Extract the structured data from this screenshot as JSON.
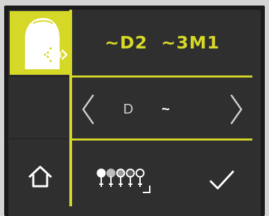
{
  "shade_panel": {
    "code": "~D2  ~3M1",
    "icons": {
      "tooth": "tooth-scan-icon",
      "home": "home-icon",
      "guide": "shade-guide-icon",
      "confirm": "checkmark-icon",
      "prev": "chevron-left-icon",
      "next": "chevron-right-icon"
    }
  },
  "selector": {
    "group_label": "D",
    "modifier_label": "~"
  },
  "colors": {
    "accent": "#d6d827",
    "screen_bg": "#2f2f2f",
    "text_light": "#ffffff",
    "text_dim": "#cfcfcf"
  }
}
